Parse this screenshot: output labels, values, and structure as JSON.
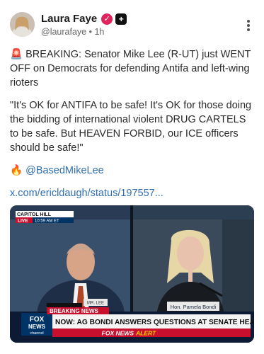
{
  "author": {
    "name": "Laura Faye",
    "handle": "@laurafaye",
    "separator": "•",
    "time": "1h",
    "verified_glyph": "✓",
    "plus_glyph": "+"
  },
  "post": {
    "alert_emoji": "🚨",
    "line1": " BREAKING: Senator Mike Lee (R-UT) just WENT OFF on Democrats for defending Antifa and left-wing rioters",
    "quote": "\"It's OK for ANTIFA to be safe! It's OK for those doing the bidding of international violent DRUG CARTELS to be safe. But HEAVEN FORBID, our ICE officers should be safe!\"",
    "fire_emoji": "🔥",
    "mention": "@BasedMikeLee",
    "link": "x.com/ericldaugh/status/197557..."
  },
  "video": {
    "location": "CAPITOL HILL",
    "live_label": "LIVE",
    "live_time": "10:59 AM ET",
    "nameplate_left": "MR. LEE",
    "nameplate_right": "Hon. Pamela Bondi",
    "breaking_label": "BREAKING NEWS",
    "headline": "NOW: AG BONDI ANSWERS QUESTIONS AT SENATE HEARING",
    "network_logo_top": "FOX",
    "network_logo_mid": "NEWS",
    "network_logo_bottom": "channel",
    "alert_brand": "FOX NEWS",
    "alert_word": "ALERT"
  },
  "icons": [
    "avatar",
    "verified-icon",
    "plus-icon",
    "more-options-icon"
  ],
  "colors": {
    "link": "#2f6fb2",
    "badge": "#e0245e",
    "breaking": "#c8102e",
    "fox_blue": "#003366"
  }
}
